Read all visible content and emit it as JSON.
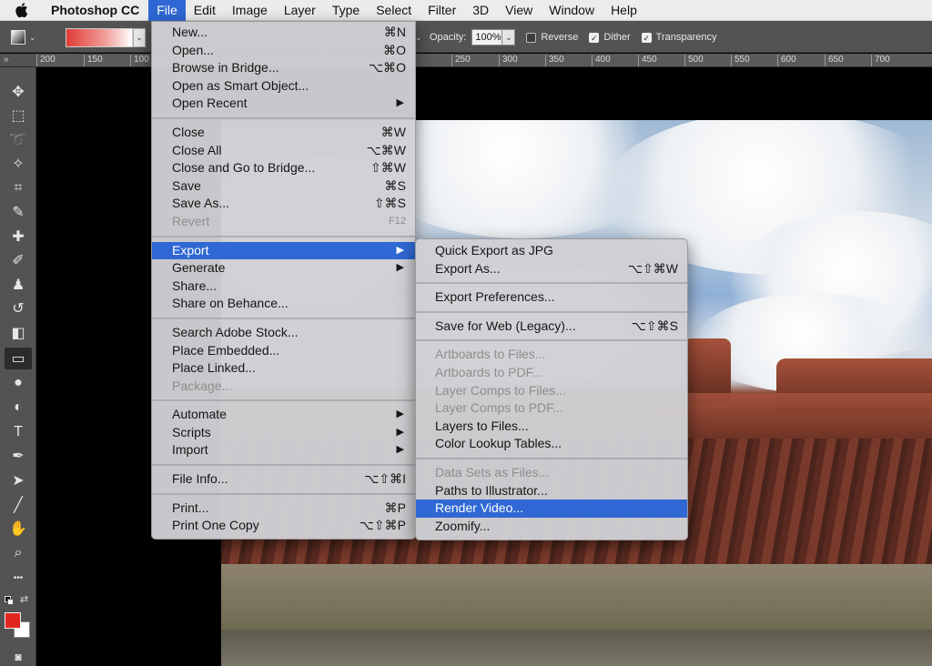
{
  "menubar": {
    "app_name": "Photoshop CC",
    "items": [
      "File",
      "Edit",
      "Image",
      "Layer",
      "Type",
      "Select",
      "Filter",
      "3D",
      "View",
      "Window",
      "Help"
    ]
  },
  "options": {
    "opacity_label": "Opacity:",
    "opacity_value": "100%",
    "reverse_label": "Reverse",
    "reverse_checked": false,
    "dither_label": "Dither",
    "dither_checked": true,
    "transparency_label": "Transparency",
    "transparency_checked": true,
    "gradient_colors": [
      "#e23b35",
      "#ffffff"
    ]
  },
  "ruler": {
    "corner": "»",
    "ticks": [
      "200",
      "150",
      "100",
      "300",
      "250",
      "300",
      "350",
      "400",
      "450",
      "500",
      "550",
      "600",
      "650",
      "700"
    ]
  },
  "colors": {
    "foreground": "#e2261f",
    "background": "#ffffff",
    "highlight": "#2f68d4"
  },
  "file_menu": {
    "groups": [
      [
        {
          "label": "New...",
          "shortcut": "⌘N"
        },
        {
          "label": "Open...",
          "shortcut": "⌘O"
        },
        {
          "label": "Browse in Bridge...",
          "shortcut": "⌥⌘O"
        },
        {
          "label": "Open as Smart Object..."
        },
        {
          "label": "Open Recent",
          "submenu": true
        }
      ],
      [
        {
          "label": "Close",
          "shortcut": "⌘W"
        },
        {
          "label": "Close All",
          "shortcut": "⌥⌘W"
        },
        {
          "label": "Close and Go to Bridge...",
          "shortcut": "⇧⌘W"
        },
        {
          "label": "Save",
          "shortcut": "⌘S"
        },
        {
          "label": "Save As...",
          "shortcut": "⇧⌘S"
        },
        {
          "label": "Revert",
          "shortcut": "F12",
          "disabled": true
        }
      ],
      [
        {
          "label": "Export",
          "submenu": true,
          "highlighted": true
        },
        {
          "label": "Generate",
          "submenu": true
        },
        {
          "label": "Share..."
        },
        {
          "label": "Share on Behance..."
        }
      ],
      [
        {
          "label": "Search Adobe Stock..."
        },
        {
          "label": "Place Embedded..."
        },
        {
          "label": "Place Linked..."
        },
        {
          "label": "Package...",
          "disabled": true
        }
      ],
      [
        {
          "label": "Automate",
          "submenu": true
        },
        {
          "label": "Scripts",
          "submenu": true
        },
        {
          "label": "Import",
          "submenu": true
        }
      ],
      [
        {
          "label": "File Info...",
          "shortcut": "⌥⇧⌘I"
        }
      ],
      [
        {
          "label": "Print...",
          "shortcut": "⌘P"
        },
        {
          "label": "Print One Copy",
          "shortcut": "⌥⇧⌘P"
        }
      ]
    ]
  },
  "export_menu": {
    "groups": [
      [
        {
          "label": "Quick Export as JPG"
        },
        {
          "label": "Export As...",
          "shortcut": "⌥⇧⌘W"
        }
      ],
      [
        {
          "label": "Export Preferences..."
        }
      ],
      [
        {
          "label": "Save for Web (Legacy)...",
          "shortcut": "⌥⇧⌘S"
        }
      ],
      [
        {
          "label": "Artboards to Files...",
          "disabled": true
        },
        {
          "label": "Artboards to PDF...",
          "disabled": true
        },
        {
          "label": "Layer Comps to Files...",
          "disabled": true
        },
        {
          "label": "Layer Comps to PDF...",
          "disabled": true
        },
        {
          "label": "Layers to Files..."
        },
        {
          "label": "Color Lookup Tables..."
        }
      ],
      [
        {
          "label": "Data Sets as Files...",
          "disabled": true
        },
        {
          "label": "Paths to Illustrator..."
        },
        {
          "label": "Render Video...",
          "highlighted": true
        },
        {
          "label": "Zoomify..."
        }
      ]
    ]
  },
  "tools": [
    {
      "icon": "move-icon",
      "glyph": "✥"
    },
    {
      "icon": "marquee-icon",
      "glyph": "⬚"
    },
    {
      "icon": "lasso-icon",
      "glyph": "➰"
    },
    {
      "icon": "magic-wand-icon",
      "glyph": "✧"
    },
    {
      "icon": "crop-icon",
      "glyph": "⌗"
    },
    {
      "icon": "eyedropper-icon",
      "glyph": "✎"
    },
    {
      "icon": "healing-brush-icon",
      "glyph": "✚"
    },
    {
      "icon": "brush-icon",
      "glyph": "✐"
    },
    {
      "icon": "clone-stamp-icon",
      "glyph": "♟"
    },
    {
      "icon": "history-brush-icon",
      "glyph": "↺"
    },
    {
      "icon": "eraser-icon",
      "glyph": "◧"
    },
    {
      "icon": "gradient-icon",
      "glyph": "▭",
      "selected": true
    },
    {
      "icon": "blur-icon",
      "glyph": "●"
    },
    {
      "icon": "dodge-icon",
      "glyph": "◐"
    },
    {
      "icon": "type-icon",
      "glyph": "T"
    },
    {
      "icon": "pen-icon",
      "glyph": "✒"
    },
    {
      "icon": "path-selection-icon",
      "glyph": "➤"
    },
    {
      "icon": "line-icon",
      "glyph": "╱"
    },
    {
      "icon": "hand-icon",
      "glyph": "✋"
    },
    {
      "icon": "zoom-icon",
      "glyph": "⌕"
    },
    {
      "icon": "more-tools-icon",
      "glyph": "•••"
    }
  ]
}
